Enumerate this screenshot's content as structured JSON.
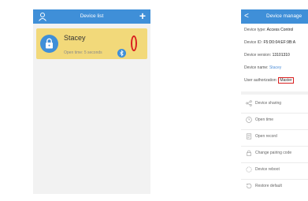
{
  "left": {
    "header": {
      "title": "Device list",
      "add_label": "+"
    },
    "card": {
      "name": "Stacey",
      "open_time": "Open time:  5 seconds"
    }
  },
  "right": {
    "header": {
      "back": "<",
      "title": "Device manage"
    },
    "info": {
      "type_label": "Device type: ",
      "type_value": "Access Control",
      "id_label": "Device ID: ",
      "id_value": "F5:D0:04:EF:9B:A",
      "version_label": "Device version: ",
      "version_value": "13101310",
      "name_label": "Device name: ",
      "name_value": "Stacey",
      "auth_label": "User authorization: ",
      "auth_value": "Master"
    },
    "menu": [
      {
        "label": "Device sharing",
        "icon": "share-icon"
      },
      {
        "label": "Open time",
        "icon": "clock-icon"
      },
      {
        "label": "Open record",
        "icon": "record-icon"
      },
      {
        "label": "Change pairing code",
        "icon": "lock-icon"
      },
      {
        "label": "Device reboot",
        "icon": "reboot-icon"
      },
      {
        "label": "Restore default",
        "icon": "restore-icon"
      }
    ]
  },
  "colors": {
    "header": "#3f8fd8",
    "card": "#f2d97a",
    "highlight": "#d91f1f"
  }
}
